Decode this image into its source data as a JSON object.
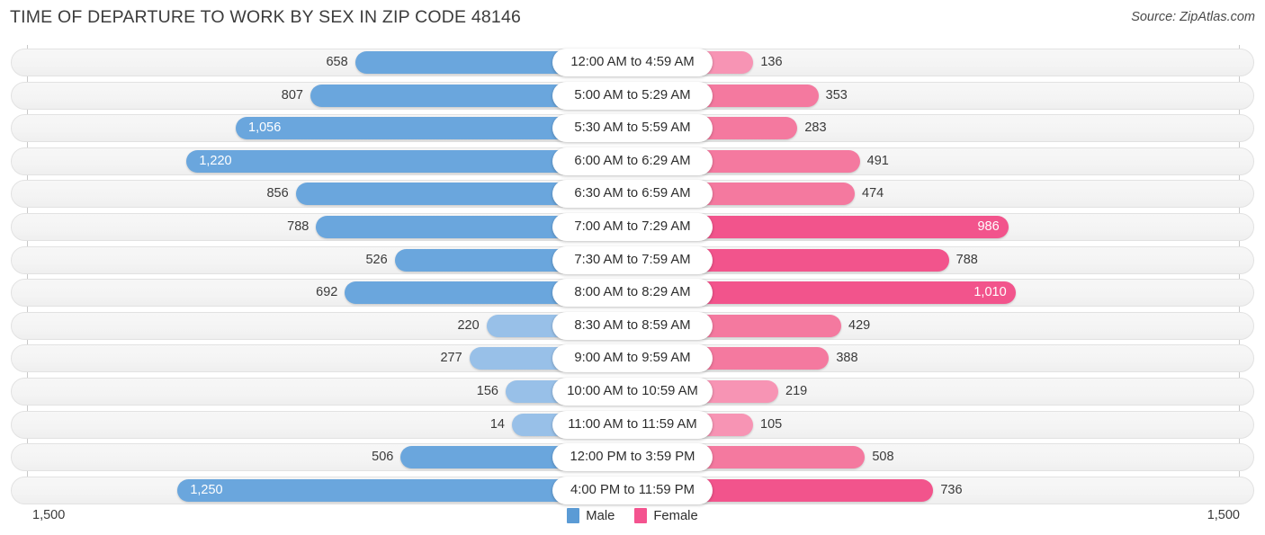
{
  "header": {
    "title": "TIME OF DEPARTURE TO WORK BY SEX IN ZIP CODE 48146",
    "source": "Source: ZipAtlas.com"
  },
  "axis": {
    "left_max_label": "1,500",
    "right_max_label": "1,500"
  },
  "legend": {
    "male": {
      "label": "Male",
      "color": "#5b9bd5"
    },
    "female": {
      "label": "Female",
      "color": "#f4538f"
    }
  },
  "chart_data": {
    "type": "bar",
    "title": "TIME OF DEPARTURE TO WORK BY SEX IN ZIP CODE 48146",
    "subtitle": "Source: ZipAtlas.com",
    "orientation": "horizontal-diverging",
    "xlabel": "",
    "ylabel": "",
    "xlim": [
      0,
      1500
    ],
    "grid": true,
    "legend_position": "bottom-center",
    "categories": [
      "12:00 AM to 4:59 AM",
      "5:00 AM to 5:29 AM",
      "5:30 AM to 5:59 AM",
      "6:00 AM to 6:29 AM",
      "6:30 AM to 6:59 AM",
      "7:00 AM to 7:29 AM",
      "7:30 AM to 7:59 AM",
      "8:00 AM to 8:29 AM",
      "8:30 AM to 8:59 AM",
      "9:00 AM to 9:59 AM",
      "10:00 AM to 10:59 AM",
      "11:00 AM to 11:59 AM",
      "12:00 PM to 3:59 PM",
      "4:00 PM to 11:59 PM"
    ],
    "series": [
      {
        "name": "Male",
        "color": "#5b9bd5",
        "values": [
          658,
          807,
          1056,
          1220,
          856,
          788,
          526,
          692,
          220,
          277,
          156,
          14,
          506,
          1250
        ],
        "labels": [
          "658",
          "807",
          "1,056",
          "1,220",
          "856",
          "788",
          "526",
          "692",
          "220",
          "277",
          "156",
          "14",
          "506",
          "1,250"
        ]
      },
      {
        "name": "Female",
        "color": "#f4538f",
        "values": [
          136,
          353,
          283,
          491,
          474,
          986,
          788,
          1010,
          429,
          388,
          219,
          105,
          508,
          736
        ],
        "labels": [
          "136",
          "353",
          "283",
          "491",
          "474",
          "986",
          "788",
          "1,010",
          "429",
          "388",
          "219",
          "105",
          "508",
          "736"
        ]
      }
    ]
  },
  "rows": [
    {
      "category": "12:00 AM to 4:59 AM",
      "male": 658,
      "male_label": "658",
      "female": 136,
      "female_label": "136"
    },
    {
      "category": "5:00 AM to 5:29 AM",
      "male": 807,
      "male_label": "807",
      "female": 353,
      "female_label": "353"
    },
    {
      "category": "5:30 AM to 5:59 AM",
      "male": 1056,
      "male_label": "1,056",
      "female": 283,
      "female_label": "283"
    },
    {
      "category": "6:00 AM to 6:29 AM",
      "male": 1220,
      "male_label": "1,220",
      "female": 491,
      "female_label": "491"
    },
    {
      "category": "6:30 AM to 6:59 AM",
      "male": 856,
      "male_label": "856",
      "female": 474,
      "female_label": "474"
    },
    {
      "category": "7:00 AM to 7:29 AM",
      "male": 788,
      "male_label": "788",
      "female": 986,
      "female_label": "986"
    },
    {
      "category": "7:30 AM to 7:59 AM",
      "male": 526,
      "male_label": "526",
      "female": 788,
      "female_label": "788"
    },
    {
      "category": "8:00 AM to 8:29 AM",
      "male": 692,
      "male_label": "692",
      "female": 1010,
      "female_label": "1,010"
    },
    {
      "category": "8:30 AM to 8:59 AM",
      "male": 220,
      "male_label": "220",
      "female": 429,
      "female_label": "429"
    },
    {
      "category": "9:00 AM to 9:59 AM",
      "male": 277,
      "male_label": "277",
      "female": 388,
      "female_label": "388"
    },
    {
      "category": "10:00 AM to 10:59 AM",
      "male": 156,
      "male_label": "156",
      "female": 219,
      "female_label": "219"
    },
    {
      "category": "11:00 AM to 11:59 AM",
      "male": 14,
      "male_label": "14",
      "female": 105,
      "female_label": "105"
    },
    {
      "category": "12:00 PM to 3:59 PM",
      "male": 506,
      "male_label": "506",
      "female": 508,
      "female_label": "508"
    },
    {
      "category": "4:00 PM to 11:59 PM",
      "male": 1250,
      "male_label": "1,250",
      "female": 736,
      "female_label": "736"
    }
  ]
}
